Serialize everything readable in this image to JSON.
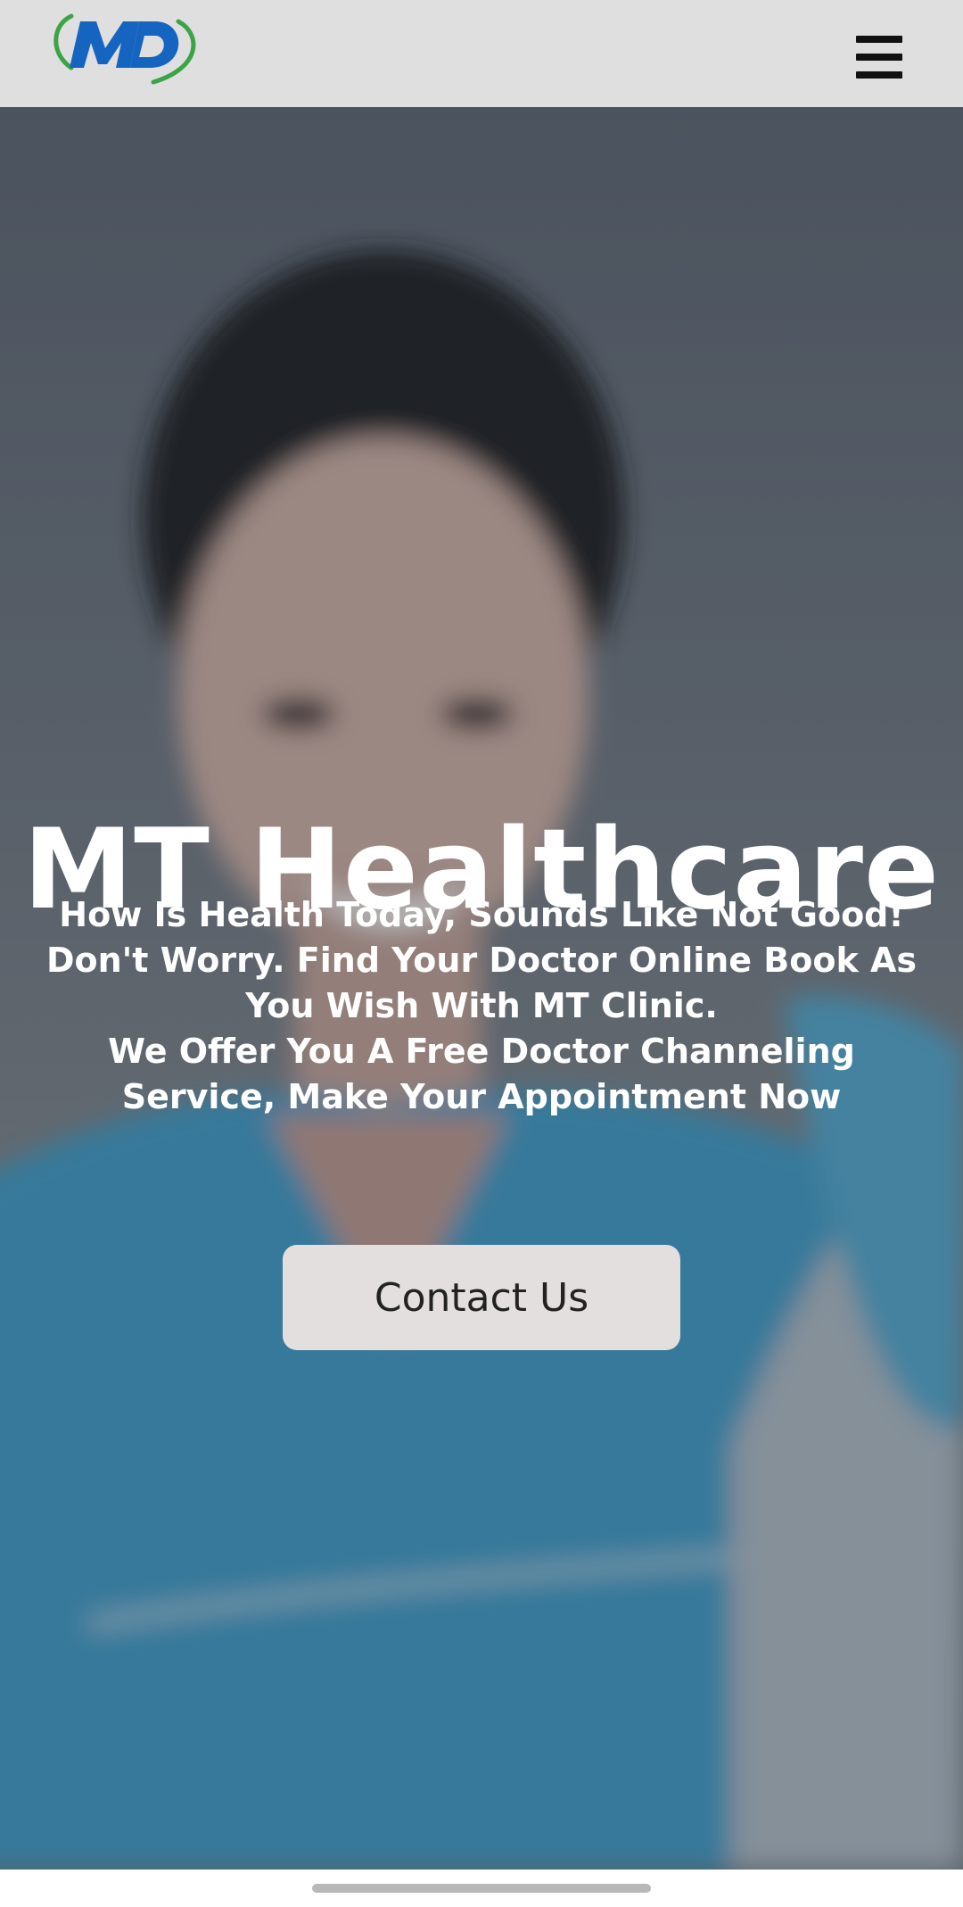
{
  "header": {
    "logo_text": "MD",
    "logo_color_blue": "#1565c0",
    "logo_color_green": "#3aa447",
    "menu_icon": "hamburger-menu-icon"
  },
  "hero": {
    "title": "MT Healthcare",
    "lines": [
      "How Is Health Today, Sounds Like Not Good!",
      "Don't Worry. Find Your Doctor Online Book As",
      "You Wish With MT Clinic.",
      "We Offer You A Free Doctor Channeling",
      "Service, Make Your Appointment Now"
    ],
    "cta_label": "Contact Us"
  }
}
